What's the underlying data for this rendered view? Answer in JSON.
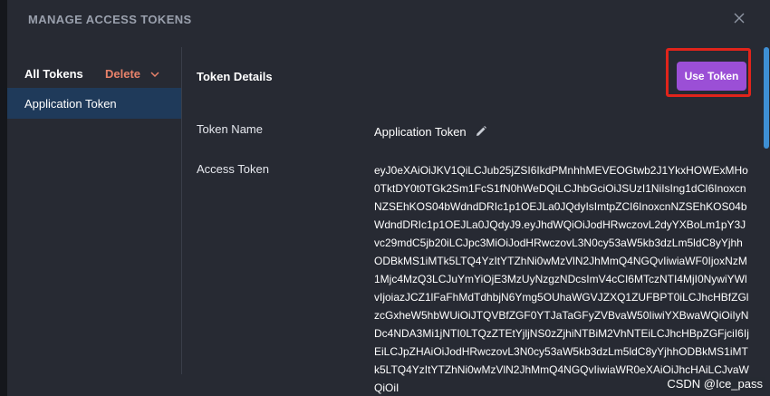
{
  "modal": {
    "title": "MANAGE ACCESS TOKENS"
  },
  "sidebar": {
    "all_tokens_label": "All Tokens",
    "delete_label": "Delete",
    "items": [
      {
        "label": "Application Token",
        "selected": true
      }
    ]
  },
  "main": {
    "section_title": "Token Details",
    "use_token_label": "Use Token",
    "token_name_label": "Token Name",
    "token_name_value": "Application Token",
    "access_token_label": "Access Token",
    "access_token_value": "eyJ0eXAiOiJKV1QiLCJub25jZSI6IkdPMnhhMEVEOGtwb2J1YkxHOWExMHo0TktDY0t0TGk2Sm1FcS1fN0hWeDQiLCJhbGciOiJSUzI1NiIsIng1dCI6InoxcnNZSEhKOS04bWdndDRIc1p1OEJLa0JQdyIsImtpZCI6InoxcnNZSEhKOS04bWdndDRIc1p1OEJLa0JQdyJ9.eyJhdWQiOiJodHRwczovL2dyYXBoLm1pY3Jvc29mdC5jb20iLCJpc3MiOiJodHRwczovL3N0cy53aW5kb3dzLm5ldC8yYjhhODBkMS1iMTk5LTQ4YzItYTZhNi0wMzVlN2JhMmQ4NGQvIiwiaWF0IjoxNzM1Mjc4MzQ3LCJuYmYiOjE3MzUyNzgzNDcsImV4cCI6MTczNTI4MjI0NywiYWlvIjoiazJCZ1lFaFhMdTdhbjN6Ymg5OUhaWGVJZXQ1ZUFBPT0iLCJhcHBfZGlzcGxheW5hbWUiOiJTQVBfZGF0YTJaTaGFyZVBvaW50IiwiYXBwaWQiOiIyNDc4NDA3Mi1jNTI0LTQzZTEtYjljNS0zZjhiNTBiM2VhNTEiLCJhcHBpZGFjciI6IjEiLCJpZHAiOiJodHRwczovL3N0cy53aW5kb3dzLm5ldC8yYjhhODBkMS1iMTk5LTQ4YzItYTZhNi0wMzVlN2JhMmQ4NGQvIiwiaWR0eXAiOiJhcHAiLCJvaWQiOiI"
  },
  "watermark": "CSDN @Ice_pass",
  "colors": {
    "modal_bg": "#272a33",
    "selected_item_bg": "#1f3a5a",
    "accent_purple": "#9b4fd6",
    "delete_orange": "#e8826a",
    "highlight_red": "#e0241b",
    "scroll_blue": "#3e8fd4"
  }
}
